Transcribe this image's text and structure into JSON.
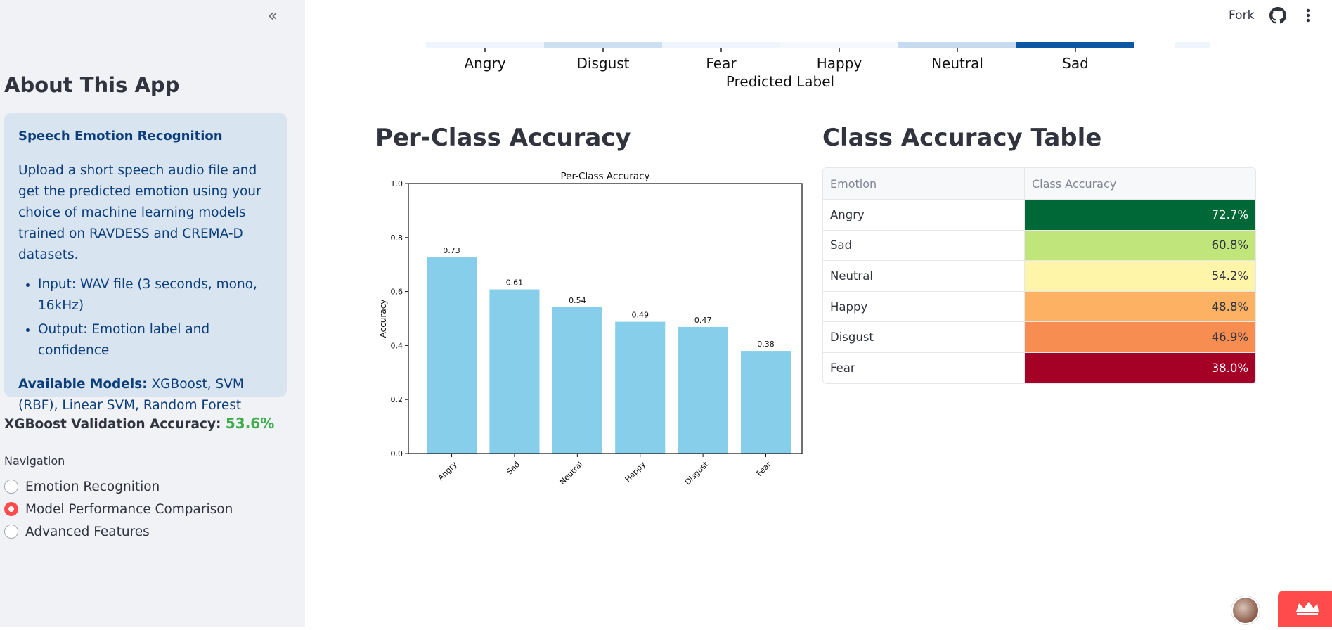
{
  "sidebar": {
    "collapse_glyph": "«",
    "about_title": "About This App",
    "info": {
      "heading": "Speech Emotion Recognition",
      "description": "Upload a short speech audio file and get the predicted emotion using your choice of machine learning models trained on RAVDESS and CREMA-D datasets.",
      "bullets": [
        "Input: WAV file (3 seconds, mono, 16kHz)",
        "Output: Emotion label and confidence"
      ],
      "models_label": "Available Models:",
      "models_value": "XGBoost, SVM (RBF), Linear SVM, Random Forest"
    },
    "validation_label": "XGBoost Validation Accuracy:",
    "validation_value": "53.6%",
    "nav_label": "Navigation",
    "nav_items": [
      {
        "label": "Emotion Recognition",
        "selected": false
      },
      {
        "label": "Model Performance Comparison",
        "selected": true
      },
      {
        "label": "Advanced Features",
        "selected": false
      }
    ]
  },
  "header": {
    "fork_label": "Fork",
    "github_icon": "github-icon",
    "menu_icon": "kebab-menu-icon"
  },
  "confusion_matrix_partial": {
    "tick_labels": [
      "Angry",
      "Disgust",
      "Fear",
      "Happy",
      "Neutral",
      "Sad"
    ],
    "xlabel": "Predicted Label",
    "strip_colors": [
      "#eef5fc",
      "#cde0f1",
      "#eef5fc",
      "#f5f9fe",
      "#c6dbef",
      "#0d56a2",
      "#ffffff",
      "#eef5fc"
    ]
  },
  "per_class_section_title": "Per-Class Accuracy",
  "table_section_title": "Class Accuracy Table",
  "chart_data": {
    "type": "bar",
    "title": "Per-Class Accuracy",
    "xlabel": "",
    "ylabel": "Accuracy",
    "categories": [
      "Angry",
      "Sad",
      "Neutral",
      "Happy",
      "Disgust",
      "Fear"
    ],
    "values": [
      0.727,
      0.608,
      0.542,
      0.488,
      0.469,
      0.38
    ],
    "data_labels": [
      "0.73",
      "0.61",
      "0.54",
      "0.49",
      "0.47",
      "0.38"
    ],
    "ylim": [
      0,
      1.0
    ],
    "yticks": [
      "0.0",
      "0.2",
      "0.4",
      "0.6",
      "0.8",
      "1.0"
    ],
    "bar_color": "#87ceeb",
    "grid": false
  },
  "table": {
    "headers": [
      "Emotion",
      "Class Accuracy"
    ],
    "rows": [
      {
        "emotion": "Angry",
        "accuracy": "72.7%",
        "bg": "#006837",
        "fg": "#ffffff"
      },
      {
        "emotion": "Sad",
        "accuracy": "60.8%",
        "bg": "#c0e57a",
        "fg": "#31333f"
      },
      {
        "emotion": "Neutral",
        "accuracy": "54.2%",
        "bg": "#fef5a9",
        "fg": "#31333f"
      },
      {
        "emotion": "Happy",
        "accuracy": "48.8%",
        "bg": "#fdb163",
        "fg": "#31333f"
      },
      {
        "emotion": "Disgust",
        "accuracy": "46.9%",
        "bg": "#f88d51",
        "fg": "#31333f"
      },
      {
        "emotion": "Fear",
        "accuracy": "38.0%",
        "bg": "#a50026",
        "fg": "#ffffff"
      }
    ]
  }
}
